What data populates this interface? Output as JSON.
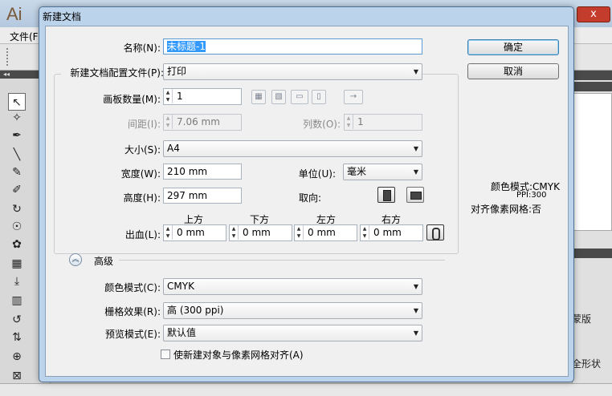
{
  "app": {
    "logo": "Ai",
    "menu_file": "文件(F)",
    "close_glyph": "x"
  },
  "right_panel": {
    "fragment_1": "蒙版",
    "fragment_2": "全形状"
  },
  "dialog": {
    "title": "新建文档",
    "name_label": "名称(N):",
    "name_value": "未标题-1",
    "ok_label": "确定",
    "cancel_label": "取消",
    "profile_label": "新建文档配置文件(P):",
    "profile_value": "打印",
    "artboards_label": "画板数量(M):",
    "artboards_value": "1",
    "spacing_label": "间距(I):",
    "spacing_value": "7.06 mm",
    "columns_label": "列数(O):",
    "columns_value": "1",
    "size_label": "大小(S):",
    "size_value": "A4",
    "width_label": "宽度(W):",
    "width_value": "210 mm",
    "units_label": "单位(U):",
    "units_value": "毫米",
    "height_label": "高度(H):",
    "height_value": "297 mm",
    "orientation_label": "取向:",
    "bleed_label": "出血(L):",
    "bleed_top_label": "上方",
    "bleed_bottom_label": "下方",
    "bleed_left_label": "左方",
    "bleed_right_label": "右方",
    "bleed_top": "0 mm",
    "bleed_bottom": "0 mm",
    "bleed_left": "0 mm",
    "bleed_right": "0 mm",
    "advanced_label": "高级",
    "color_mode_label": "颜色模式(C):",
    "color_mode_value": "CMYK",
    "raster_label": "栅格效果(R):",
    "raster_value": "高 (300 ppi)",
    "preview_label": "预览模式(E):",
    "preview_value": "默认值",
    "align_pixel_label": "使新建对象与像素网格对齐(A)",
    "align_pixel_checked": false,
    "summary": {
      "color_mode": "颜色模式:CMYK",
      "ppi": "PPI:300",
      "pixel_grid": "对齐像素网格:否"
    }
  }
}
